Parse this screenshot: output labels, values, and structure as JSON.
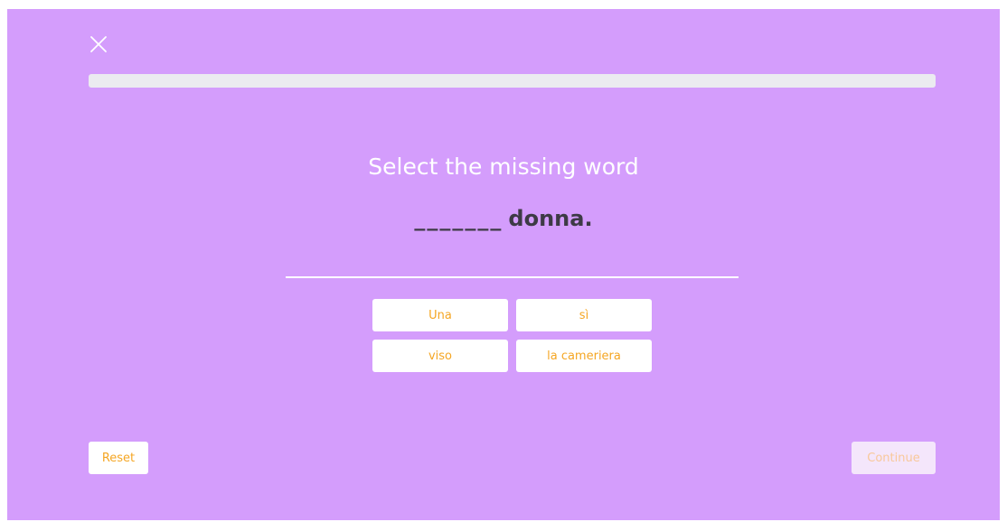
{
  "colors": {
    "background": "#d49dfc",
    "accent": "#f5a623",
    "text_dark": "#3d3a45",
    "progress_track": "#ebebf0"
  },
  "header": {
    "close_icon": "close-icon",
    "progress": 0
  },
  "exercise": {
    "prompt": "Select the missing word",
    "blank": "_______",
    "sentence_after": "donna."
  },
  "choices": [
    {
      "label": "Una"
    },
    {
      "label": "sì"
    },
    {
      "label": "viso"
    },
    {
      "label": "la cameriera"
    }
  ],
  "footer": {
    "reset_label": "Reset",
    "continue_label": "Continue",
    "continue_enabled": false
  }
}
